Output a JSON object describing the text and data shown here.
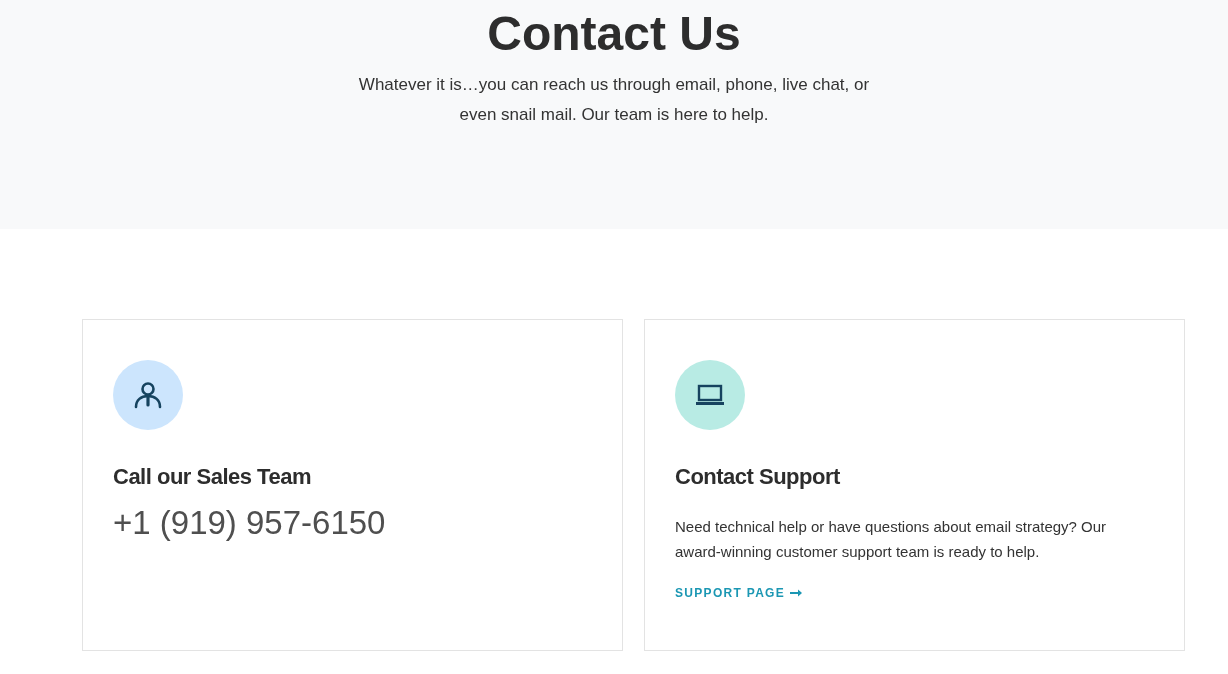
{
  "hero": {
    "title": "Contact Us",
    "subtitle": "Whatever it is…you can reach us through email, phone, live chat, or even snail mail. Our team is here to help."
  },
  "cards": [
    {
      "kind": "phone",
      "color": "#cce5fd",
      "title": "Call our Sales Team",
      "phone": "+1 (919) 957-6150"
    },
    {
      "kind": "text",
      "color": "#b8ebe4",
      "title": "Contact Support",
      "text": "Need technical help or have questions about email strategy? Our award-winning customer support team is ready to help.",
      "link": "SUPPORT PAGE"
    }
  ]
}
